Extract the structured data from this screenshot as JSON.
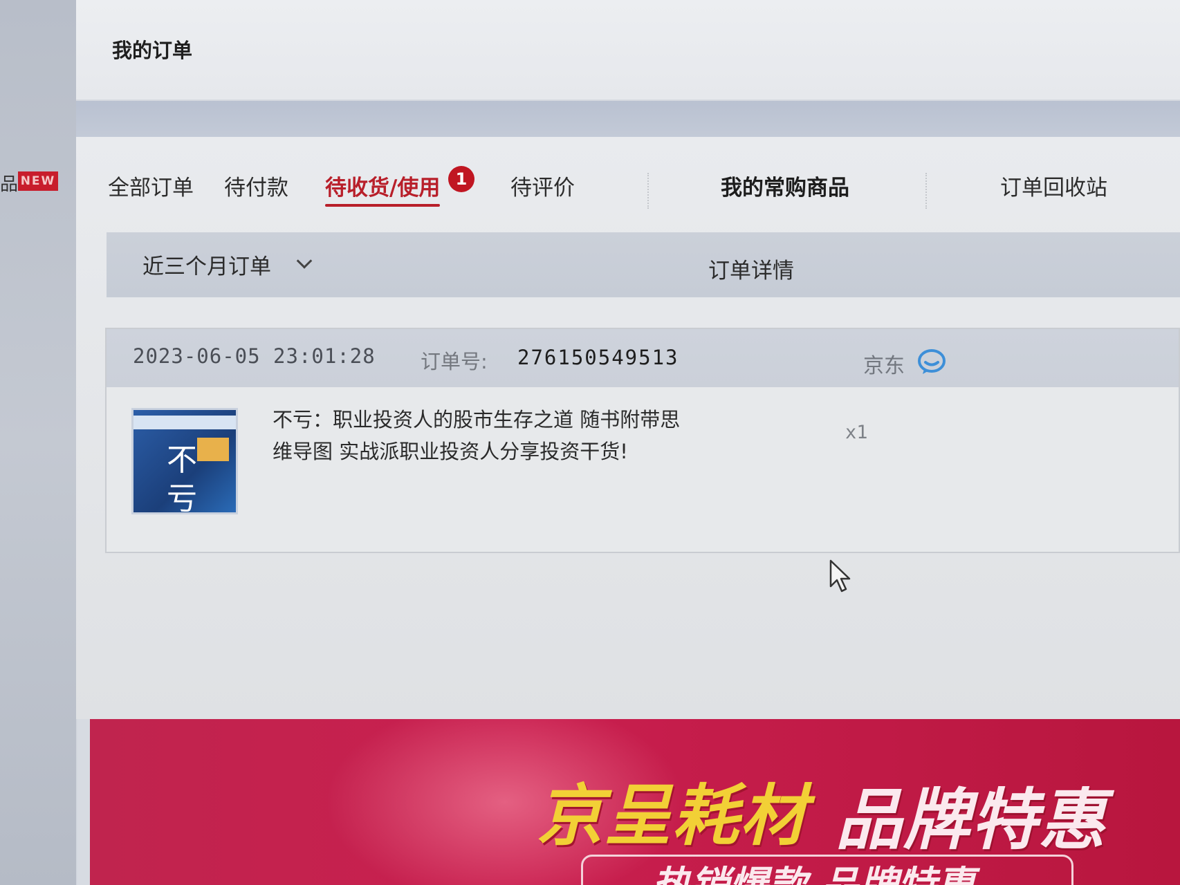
{
  "sidebar": {
    "item_fragment": "品",
    "new_badge": "NEW"
  },
  "header": {
    "title": "我的订单"
  },
  "tabs": [
    {
      "label": "全部订单"
    },
    {
      "label": "待付款"
    },
    {
      "label": "待收货/使用",
      "badge": "1",
      "active": true
    },
    {
      "label": "待评价"
    }
  ],
  "extra_tabs": {
    "frequent": "我的常购商品",
    "recycle": "订单回收站"
  },
  "filter": {
    "range": "近三个月订单",
    "detail": "订单详情"
  },
  "order": {
    "time": "2023-06-05 23:01:28",
    "order_no_label": "订单号:",
    "order_no": "276150549513",
    "shop": "京东",
    "product": {
      "name": "不亏：职业投资人的股市生存之道 随书附带思维导图 实战派职业投资人分享投资干货!",
      "quantity": "x1",
      "cover_chars": [
        "不",
        "亏"
      ]
    }
  },
  "banner": {
    "title_a": "京呈耗材",
    "title_b": "品牌特惠",
    "subtitle": "热销爆款 品牌特惠"
  },
  "colors": {
    "accent_red": "#b81f2a",
    "badge_red": "#c01622",
    "chat_blue": "#3d8fd8",
    "banner_yellow": "#f2d036"
  }
}
